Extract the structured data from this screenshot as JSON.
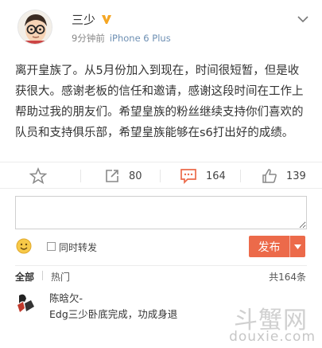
{
  "post": {
    "username": "三少",
    "time": "9分钟前",
    "source": "iPhone 6 Plus",
    "content": "离开皇族了。从5月份加入到现在，时间很短暂，但是收获很大。感谢老板的信任和邀请，感谢这段时间在工作上帮助过我的朋友们。希望皇族的粉丝继续支持你们喜欢的队员和支持俱乐部，希望皇族能够在s6打出好的成绩。"
  },
  "actions": {
    "repost_count": "80",
    "comment_count": "164",
    "like_count": "139"
  },
  "composer": {
    "repost_checkbox_label": "同时转发",
    "publish_label": "发布"
  },
  "comments": {
    "tab_all": "全部",
    "tab_hot": "热门",
    "total": "共164条",
    "first": {
      "name": "陈晗欠-",
      "text": "Edg三少卧底完成，功成身退"
    }
  },
  "watermark": {
    "big": "斗蟹网",
    "small": "douxie.com"
  },
  "colors": {
    "accent_orange": "#ec6a4a",
    "source_blue": "#6d8fb3",
    "icon_gray": "#888888"
  }
}
